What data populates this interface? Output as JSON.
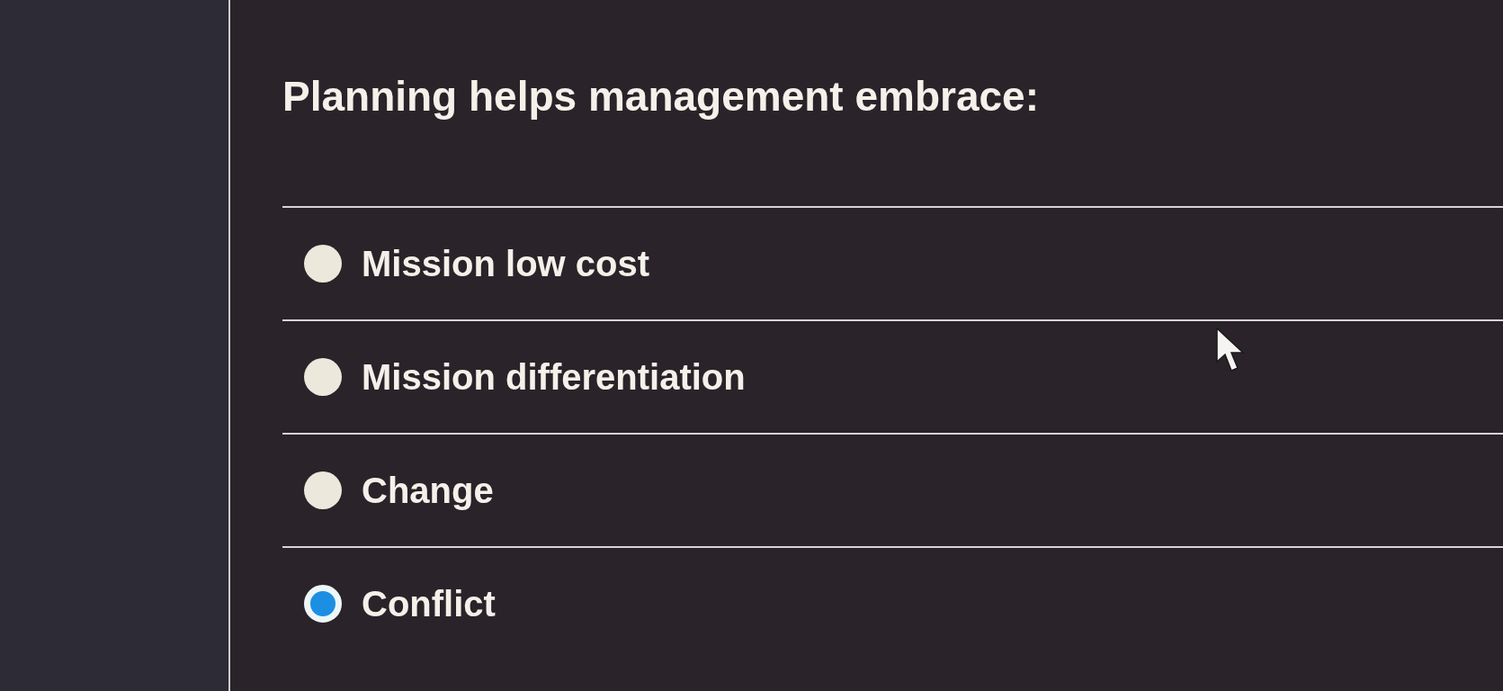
{
  "question": "Planning helps management embrace:",
  "options": [
    {
      "label": "Mission low cost",
      "selected": false
    },
    {
      "label": "Mission differentiation",
      "selected": false
    },
    {
      "label": "Change",
      "selected": false
    },
    {
      "label": "Conflict",
      "selected": true
    }
  ]
}
